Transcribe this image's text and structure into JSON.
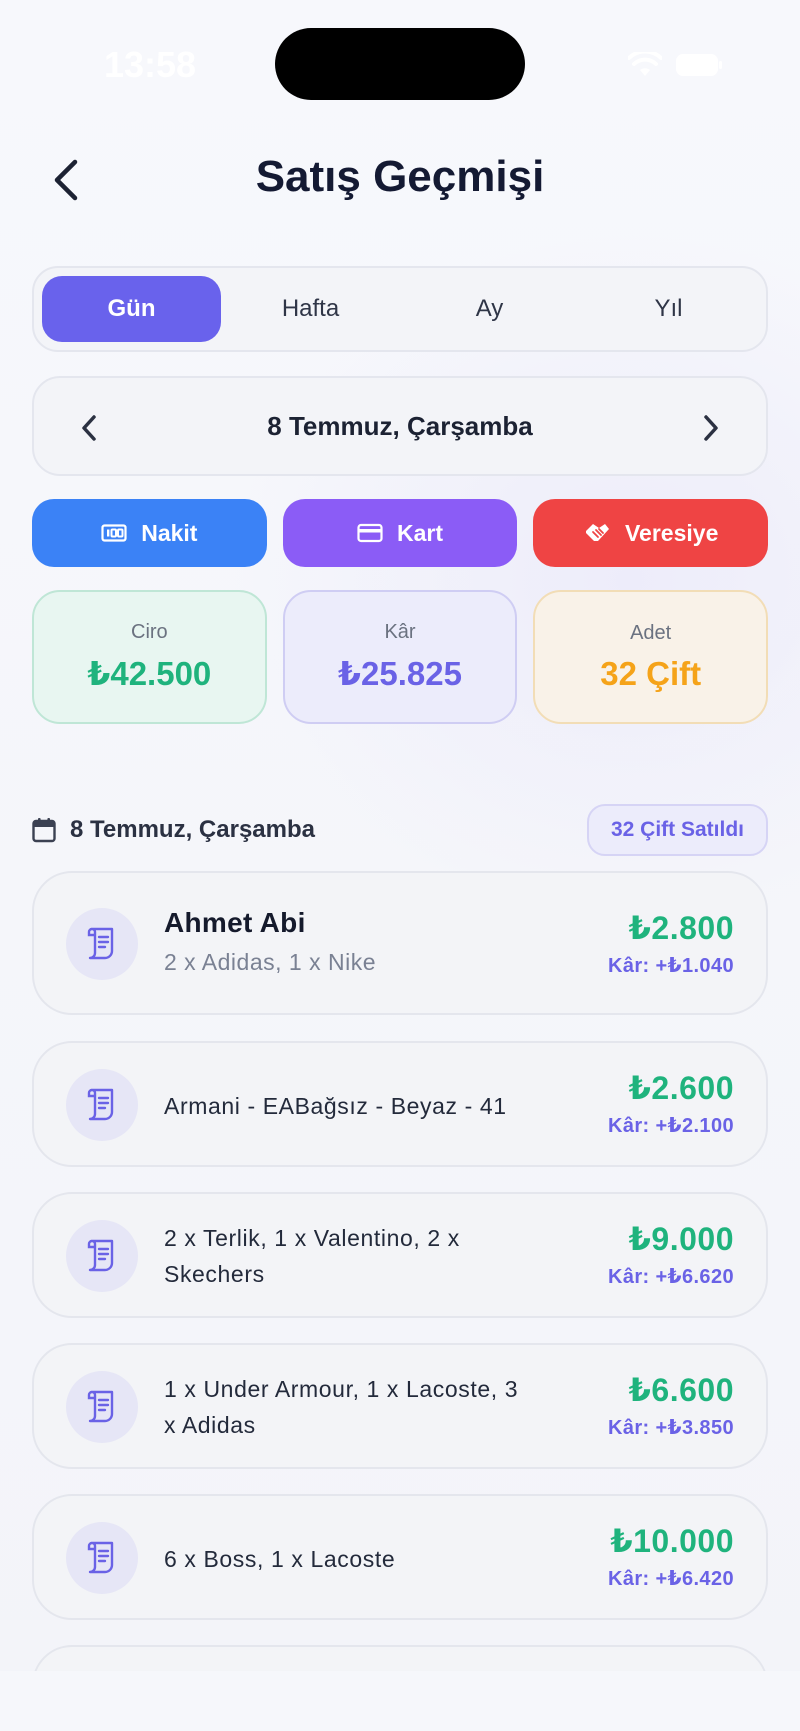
{
  "status_bar": {
    "time": "13:58"
  },
  "header": {
    "title": "Satış Geçmişi"
  },
  "segment": {
    "tabs": [
      {
        "label": "Gün",
        "active": true
      },
      {
        "label": "Hafta",
        "active": false
      },
      {
        "label": "Ay",
        "active": false
      },
      {
        "label": "Yıl",
        "active": false
      }
    ]
  },
  "date_nav": {
    "label": "8 Temmuz, Çarşamba"
  },
  "payment_filters": {
    "cash": "Nakit",
    "card": "Kart",
    "credit": "Veresiye"
  },
  "stats": {
    "revenue": {
      "label": "Ciro",
      "value": "₺42.500"
    },
    "profit": {
      "label": "Kâr",
      "value": "₺25.825"
    },
    "count": {
      "label": "Adet",
      "value": "32 Çift"
    }
  },
  "day_section": {
    "title": "8 Temmuz, Çarşamba",
    "badge": "32 Çift Satıldı"
  },
  "sales": [
    {
      "customer": "Ahmet Abi",
      "items": "2 x Adidas, 1 x Nike",
      "total": "₺2.800",
      "profit": "Kâr: +₺1.040"
    },
    {
      "description": "Armani - EABağsız - Beyaz - 41",
      "total": "₺2.600",
      "profit": "Kâr: +₺2.100"
    },
    {
      "description_line1": "2 x Terlik, 1 x Valentino, 2 x",
      "description_line2": "Skechers",
      "total": "₺9.000",
      "profit": "Kâr: +₺6.620"
    },
    {
      "description_line1": "1 x Under Armour, 1 x Lacoste, 3",
      "description_line2": "x Adidas",
      "total": "₺6.600",
      "profit": "Kâr: +₺3.850"
    },
    {
      "description": "6 x Boss, 1 x Lacoste",
      "total": "₺10.000",
      "profit": "Kâr: +₺6.420"
    }
  ],
  "colors": {
    "accent": "#6962ec",
    "cash": "#3b82f6",
    "card": "#8b5cf6",
    "credit": "#ef4444",
    "revenue": "#1fb37d",
    "count": "#f5a319"
  }
}
